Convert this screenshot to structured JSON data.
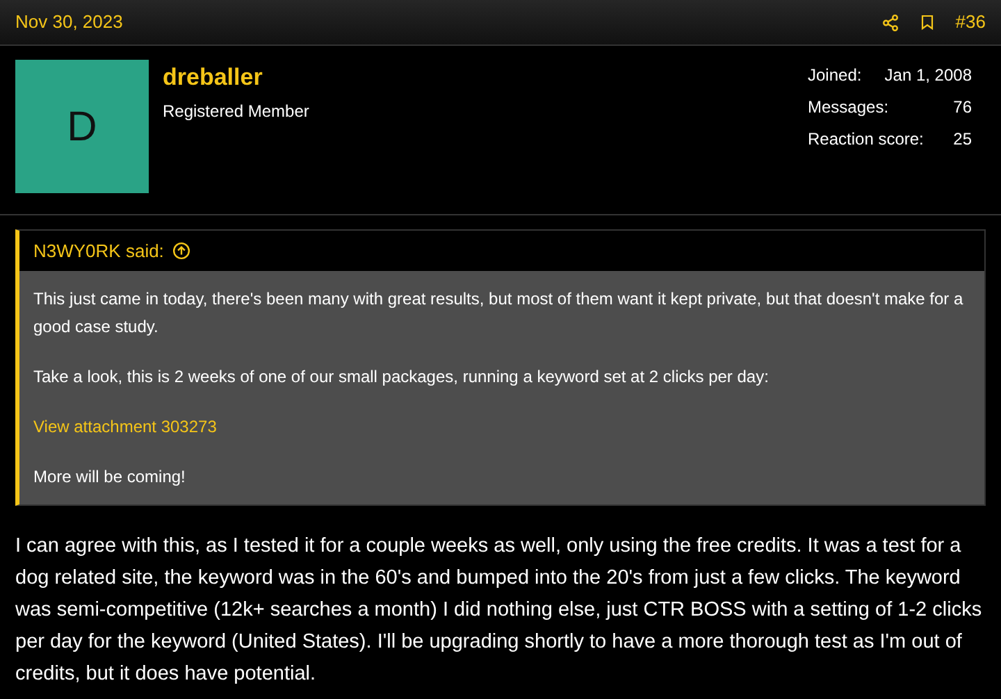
{
  "post": {
    "date": "Nov 30, 2023",
    "number": "#36"
  },
  "user": {
    "avatar_letter": "D",
    "name": "dreballer",
    "title": "Registered Member",
    "stats": [
      {
        "label": "Joined:",
        "value": "Jan 1, 2008"
      },
      {
        "label": "Messages:",
        "value": "76"
      },
      {
        "label": "Reaction score:",
        "value": "25"
      }
    ]
  },
  "quote": {
    "author": "N3WY0RK said:",
    "paragraphs": [
      {
        "kind": "text",
        "text": "This just came in today, there's been many with great results, but most of them want it kept private, but that doesn't make for a good case study."
      },
      {
        "kind": "text",
        "text": "Take a look, this is 2 weeks of one of our small packages, running a keyword set at 2 clicks per day:"
      },
      {
        "kind": "link",
        "text": "View attachment 303273"
      },
      {
        "kind": "text",
        "text": "More will be coming!"
      }
    ]
  },
  "body": "I can agree with this, as I tested it for a couple weeks as well, only using the free credits. It was a test for a dog related site, the keyword was in the 60's and bumped into the 20's from just a few clicks. The keyword was semi-competitive (12k+ searches a month) I did nothing else, just CTR BOSS with a setting of 1-2 clicks per day for the keyword (United States). I'll be upgrading shortly to have a more thorough test as I'm out of credits, but it does have potential."
}
